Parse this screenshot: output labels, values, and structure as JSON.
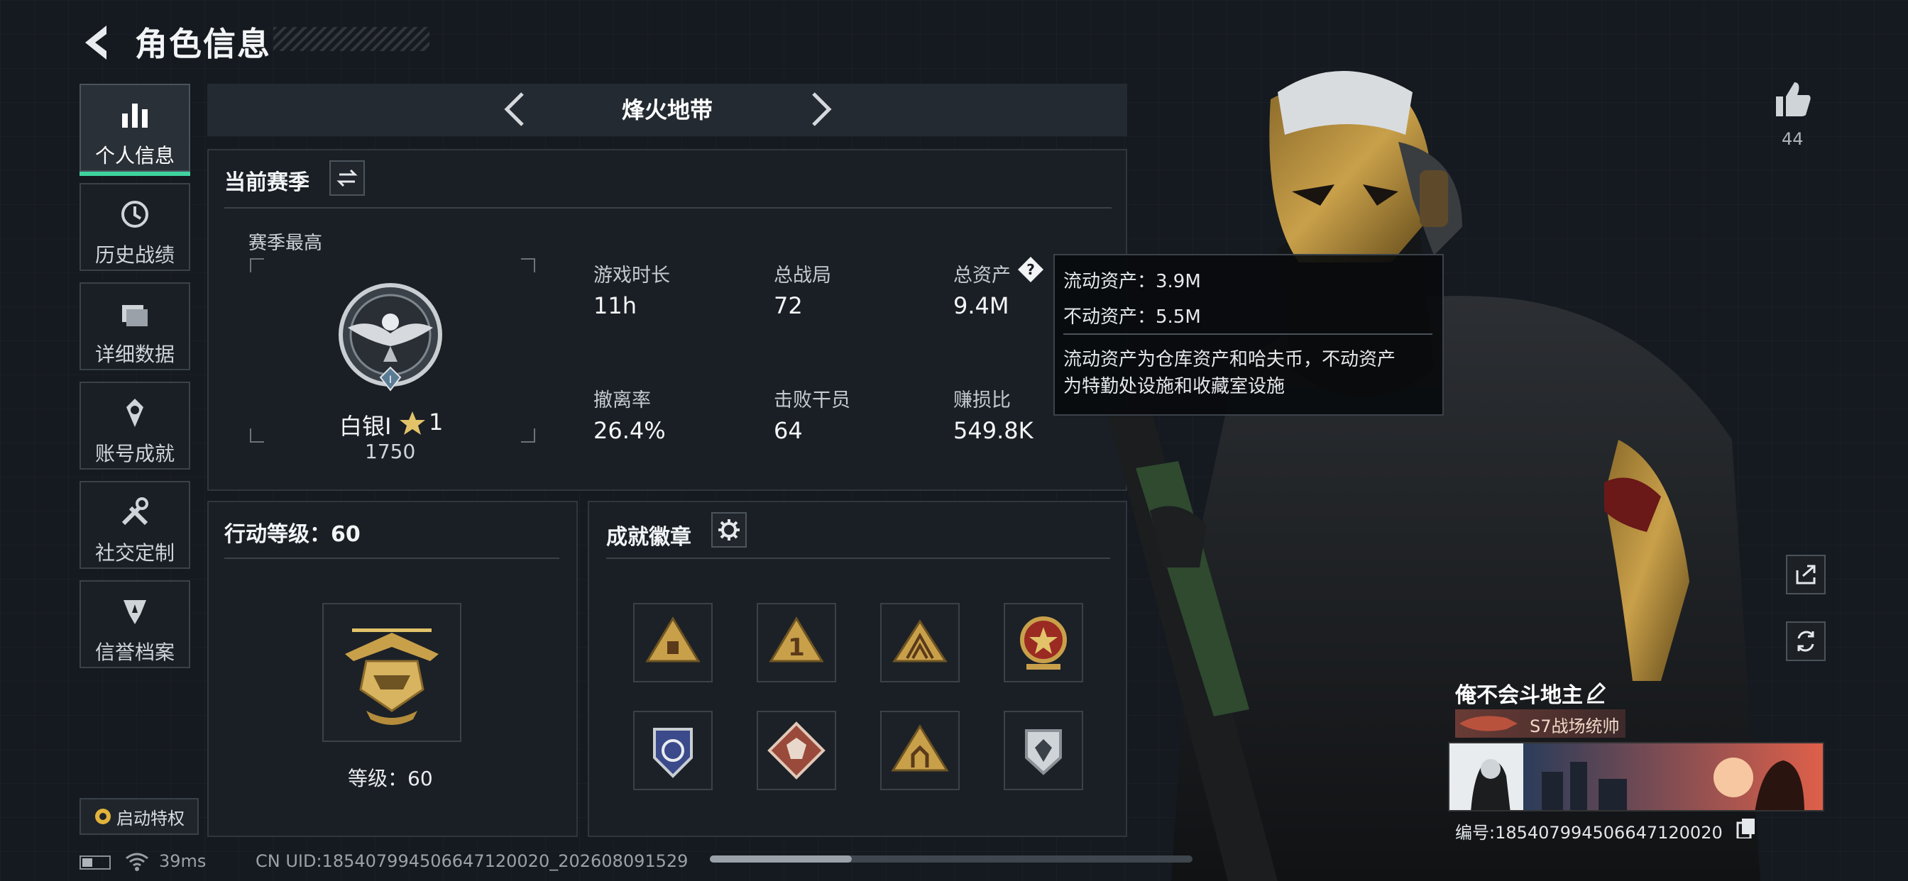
{
  "header": {
    "title": "角色信息"
  },
  "sidebar": {
    "items": [
      {
        "label": "个人信息",
        "icon": "bar-chart-icon",
        "active": true
      },
      {
        "label": "历史战绩",
        "icon": "history-icon"
      },
      {
        "label": "详细数据",
        "icon": "folder-icon"
      },
      {
        "label": "账号成就",
        "icon": "achievement-icon"
      },
      {
        "label": "社交定制",
        "icon": "tools-icon"
      },
      {
        "label": "信誉档案",
        "icon": "shield-icon"
      }
    ],
    "privilege_label": "启动特权"
  },
  "mode": {
    "title": "烽火地带"
  },
  "season": {
    "title": "当前赛季",
    "best_label": "赛季最高",
    "rank_name": "白银I",
    "rank_stars": "1",
    "rank_points": "1750",
    "rank_numeral": "I",
    "stats": [
      {
        "label": "游戏时长",
        "value": "11h"
      },
      {
        "label": "总战局",
        "value": "72"
      },
      {
        "label": "总资产",
        "value": "9.4M"
      },
      {
        "label": "撤离率",
        "value": "26.4%"
      },
      {
        "label": "击败干员",
        "value": "64"
      },
      {
        "label": "赚损比",
        "value": "549.8K"
      }
    ]
  },
  "tooltip": {
    "line1": "流动资产：3.9M",
    "line2": "不动资产：5.5M",
    "desc1": "流动资产为仓库资产和哈夫币，不动资产",
    "desc2": "为特勤处设施和收藏室设施"
  },
  "action_level": {
    "title": "行动等级：60",
    "level_label": "等级：60"
  },
  "badges": {
    "title": "成就徽章",
    "count": 8
  },
  "likes": {
    "count": "44"
  },
  "profile": {
    "name": "俺不会斗地主",
    "title": "S7战场统帅",
    "uid_label": "编号:185407994506647120020"
  },
  "footer": {
    "ping": "39ms",
    "uid": "CN UID:185407994506647120020_202608091529"
  },
  "colors": {
    "accent": "#3fd3a0",
    "panel": "#1a1f25",
    "gold": "#c9a04a"
  }
}
